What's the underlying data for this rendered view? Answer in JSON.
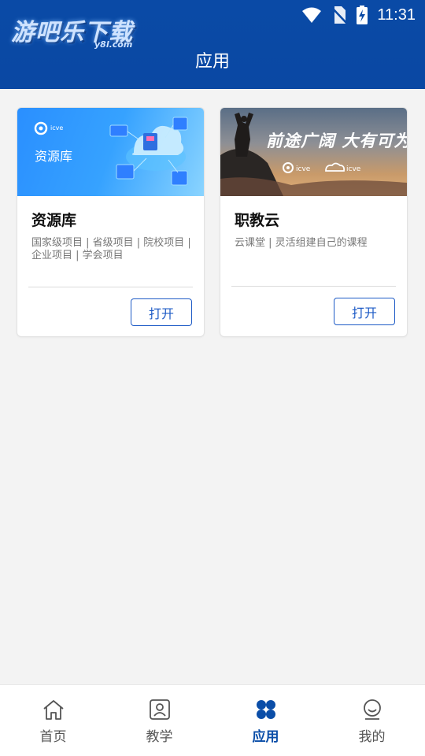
{
  "status_bar": {
    "time": "11:31"
  },
  "header": {
    "watermark_main": "游吧乐下载",
    "watermark_sub": "y8l.com",
    "title": "应用"
  },
  "cards": [
    {
      "banner_text": "资源库",
      "title": "资源库",
      "description": "国家级项目 | 省级项目 | 院校项目 | 企业项目 | 学会项目",
      "button": "打开"
    },
    {
      "banner_text": "前途广阔 大有可为",
      "title": "职教云",
      "description": "云课堂 | 灵活组建自己的课程",
      "button": "打开"
    }
  ],
  "tabbar": {
    "items": [
      {
        "label": "首页",
        "icon": "home-icon"
      },
      {
        "label": "教学",
        "icon": "teaching-icon"
      },
      {
        "label": "应用",
        "icon": "apps-icon",
        "active": true
      },
      {
        "label": "我的",
        "icon": "profile-icon"
      }
    ]
  },
  "colors": {
    "header": "#0a4aa6",
    "accent": "#1e5bc6",
    "active_tab": "#0b4ea8"
  }
}
